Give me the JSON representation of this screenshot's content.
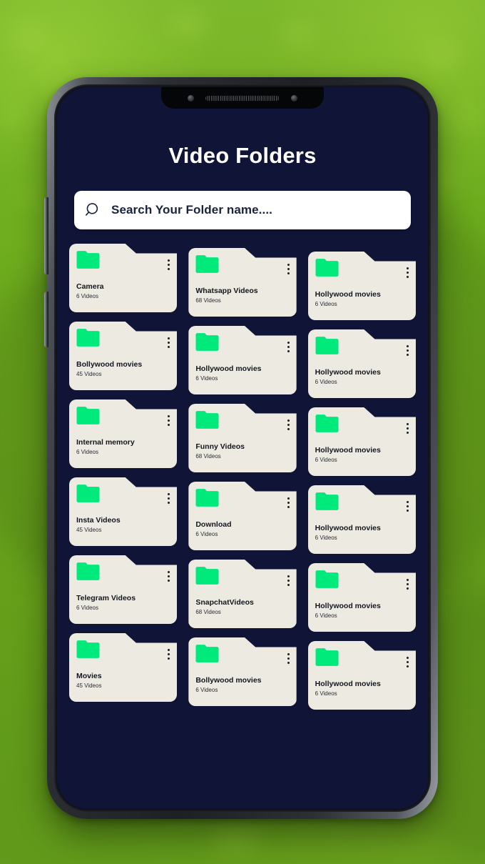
{
  "app": {
    "title": "Video Folders",
    "accent_green": "#00EA7C",
    "screen_bg": "#101538",
    "card_bg": "#ECEAE1",
    "text_dark": "#14161F"
  },
  "search": {
    "icon": "search-icon",
    "placeholder": "Search Your Folder name...."
  },
  "phone": {
    "notch": {
      "left_camera": "camera-dot",
      "speaker": "speaker-grille",
      "right_camera": "camera-dot"
    },
    "buttons": [
      "volume-rocker",
      "power-button"
    ]
  },
  "menu_icon": "three-dot-menu-icon",
  "folder_icon": "folder-icon",
  "folders": [
    {
      "name": "Camera",
      "count": "6 Videos"
    },
    {
      "name": "Whatsapp Videos",
      "count": "68 Videos"
    },
    {
      "name": "Hollywood movies",
      "count": "6 Videos"
    },
    {
      "name": "Bollywood movies",
      "count": "45 Videos"
    },
    {
      "name": "Hollywood movies",
      "count": "6 Videos"
    },
    {
      "name": "Hollywood movies",
      "count": "6 Videos"
    },
    {
      "name": "Internal memory",
      "count": "6 Videos"
    },
    {
      "name": "Funny Videos",
      "count": "68 Videos"
    },
    {
      "name": "Hollywood movies",
      "count": "6 Videos"
    },
    {
      "name": "Insta Videos",
      "count": "45 Videos"
    },
    {
      "name": "Download",
      "count": "6 Videos"
    },
    {
      "name": "Hollywood movies",
      "count": "6 Videos"
    },
    {
      "name": "Telegram Videos",
      "count": "6 Videos"
    },
    {
      "name": "SnapchatVideos",
      "count": "68 Videos"
    },
    {
      "name": "Hollywood movies",
      "count": "6 Videos"
    },
    {
      "name": "Movies",
      "count": "45 Videos"
    },
    {
      "name": "Bollywood movies",
      "count": "6 Videos"
    },
    {
      "name": "Hollywood movies",
      "count": "6 Videos"
    }
  ]
}
